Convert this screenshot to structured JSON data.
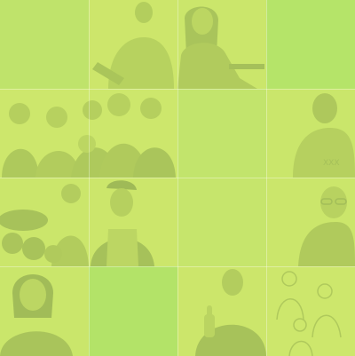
{
  "colors": {
    "tint_light": "#cde66a",
    "tint_bright": "#aee265",
    "figure": "#a8c35a",
    "grid_line": "#e2f2a8"
  },
  "tiles": [
    {
      "id": "r1c1",
      "content": "plain"
    },
    {
      "id": "r1c2",
      "content": "young-man-portrait"
    },
    {
      "id": "r1c3",
      "content": "woman-at-desk"
    },
    {
      "id": "r1c4",
      "content": "plain"
    },
    {
      "id": "r2c1",
      "content": "family-group"
    },
    {
      "id": "r2c3",
      "content": "plain"
    },
    {
      "id": "r2c4",
      "content": "man-in-shirt"
    },
    {
      "id": "r3c1",
      "content": "vendor-with-produce"
    },
    {
      "id": "r3c2",
      "content": "man-with-cap-apron"
    },
    {
      "id": "r3c3",
      "content": "plain"
    },
    {
      "id": "r3c4",
      "content": "elderly-man-glasses"
    },
    {
      "id": "r4c1",
      "content": "woman-portrait"
    },
    {
      "id": "r4c2",
      "content": "plain"
    },
    {
      "id": "r4c3",
      "content": "man-thumbs-up"
    },
    {
      "id": "r4c4",
      "content": "family-sketch"
    }
  ]
}
